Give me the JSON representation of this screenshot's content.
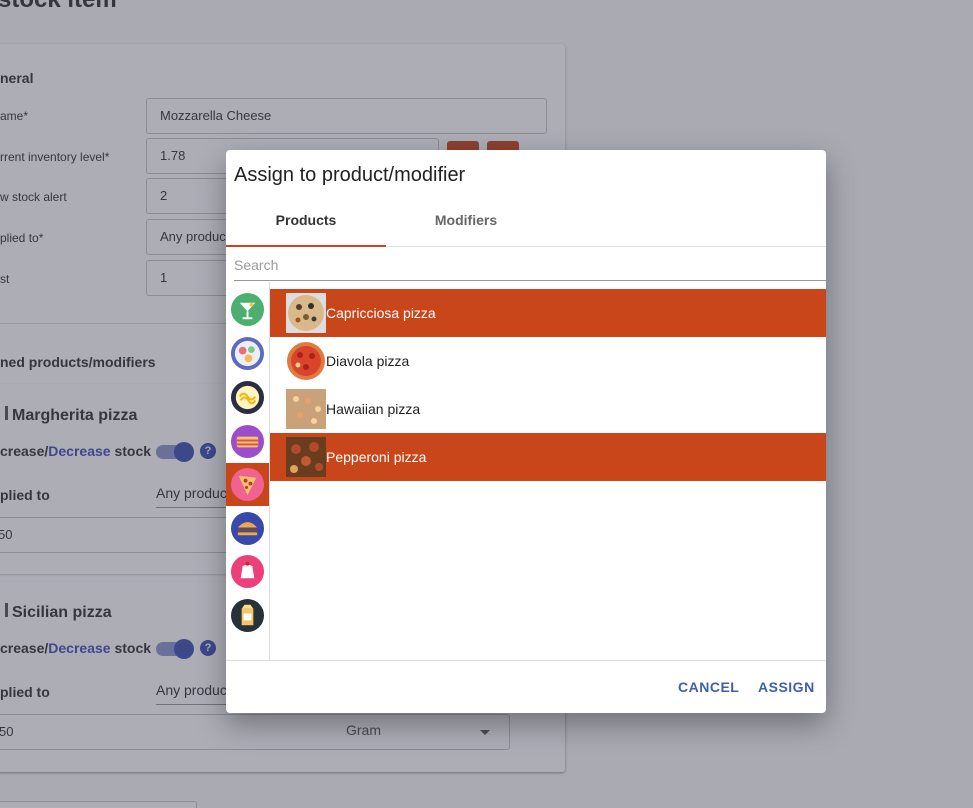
{
  "page": {
    "title": "stock item",
    "general_heading": "neral",
    "fields": [
      {
        "label": "ame*",
        "value": "Mozzarella Cheese"
      },
      {
        "label": "rrent inventory level*",
        "value": "1.78"
      },
      {
        "label": "w stock alert",
        "value": "2"
      },
      {
        "label": "plied to*",
        "value": "Any produc"
      },
      {
        "label": "st",
        "value": "1"
      }
    ],
    "assigned_heading": "ned products/modifiers",
    "assigned": [
      {
        "name": "Margherita pizza",
        "inc_prefix": "crease/",
        "dec": "Decrease",
        "inc_suffix": " stock",
        "applied_label": "plied to",
        "applied_value": "Any produc",
        "amount": "50",
        "unit": ""
      },
      {
        "name": "Sicilian pizza",
        "inc_prefix": "crease/",
        "dec": "Decrease",
        "inc_suffix": " stock",
        "applied_label": "plied to",
        "applied_value": "Any produc",
        "amount": "50",
        "unit": "Gram"
      }
    ],
    "help_glyph": "?"
  },
  "dialog": {
    "title": "Assign to product/modifier",
    "tabs": [
      {
        "label": "Products",
        "active": true
      },
      {
        "label": "Modifiers",
        "active": false
      }
    ],
    "search_placeholder": "Search",
    "categories": [
      {
        "icon": "cocktail-icon",
        "bg": "#4caf70"
      },
      {
        "icon": "sushi-plate-icon",
        "bg": "#5c6bc0"
      },
      {
        "icon": "pasta-icon",
        "bg": "#2b2d42"
      },
      {
        "icon": "lasagna-icon",
        "bg": "#9b4dca"
      },
      {
        "icon": "pizza-slice-icon",
        "bg": "#f06292",
        "selected": true
      },
      {
        "icon": "burger-fries-icon",
        "bg": "#3949ab"
      },
      {
        "icon": "pudding-icon",
        "bg": "#ec407a"
      },
      {
        "icon": "milk-carton-icon",
        "bg": "#263238"
      }
    ],
    "products": [
      {
        "name": "Capricciosa pizza",
        "selected": true
      },
      {
        "name": "Diavola pizza",
        "selected": false
      },
      {
        "name": "Hawaiian pizza",
        "selected": false
      },
      {
        "name": "Pepperoni pizza",
        "selected": true
      }
    ],
    "cancel_label": "CANCEL",
    "assign_label": "ASSIGN"
  },
  "colors": {
    "accent": "#c9461a",
    "primary": "#3f51b5",
    "button_text": "#3f5fae"
  }
}
